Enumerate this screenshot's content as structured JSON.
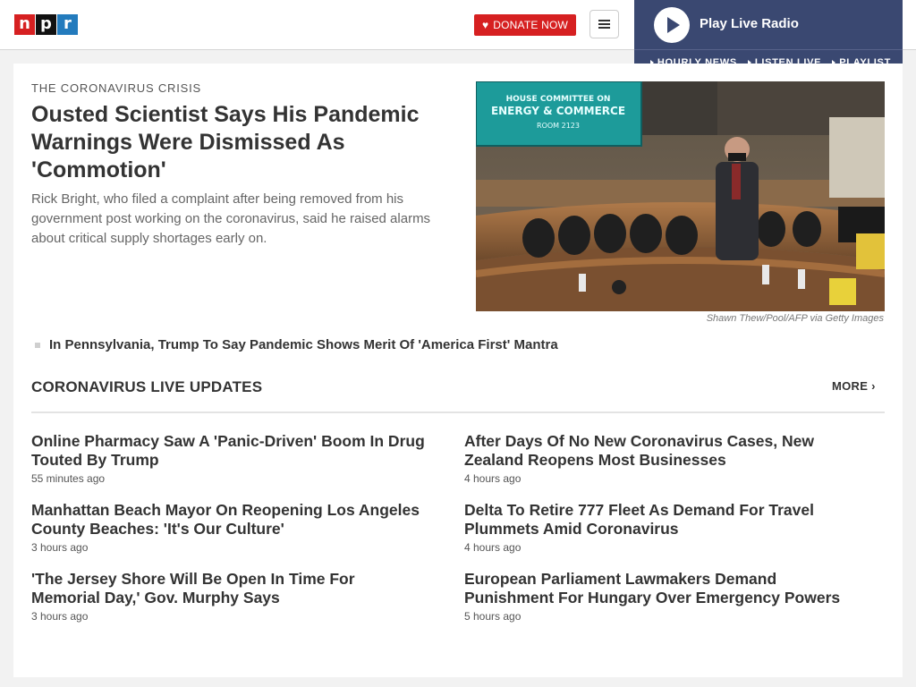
{
  "header": {
    "logo": [
      "n",
      "p",
      "r"
    ],
    "donate_label": "DONATE NOW",
    "menu_icon": "hamburger-menu-icon"
  },
  "live_radio": {
    "play_label": "Play Live Radio",
    "links": [
      "HOURLY NEWS",
      "LISTEN LIVE",
      "PLAYLIST"
    ]
  },
  "lead": {
    "kicker": "THE CORONAVIRUS CRISIS",
    "headline": "Ousted Scientist Says His Pandemic Warnings Were Dismissed As 'Commotion'",
    "teaser": "Rick Bright, who filed a complaint after being removed from his government post working on the coronavirus, said he raised alarms about critical supply shortages early on.",
    "photo_credit": "Shawn Thew/Pool/AFP via Getty Images",
    "photo_screen_text": [
      "HOUSE COMMITTEE ON",
      "ENERGY & COMMERCE",
      "ROOM 2123"
    ],
    "related": "In Pennsylvania, Trump To Say Pandemic Shows Merit Of 'America First' Mantra"
  },
  "live_updates": {
    "title": "CORONAVIRUS LIVE UPDATES",
    "more_label": "MORE ›",
    "stories": [
      {
        "title": "Online Pharmacy Saw A 'Panic-Driven' Boom In Drug Touted By Trump",
        "time": "55 minutes ago"
      },
      {
        "title": "After Days Of No New Coronavirus Cases, New Zealand Reopens Most Businesses",
        "time": "4 hours ago"
      },
      {
        "title": "Manhattan Beach Mayor On Reopening Los Angeles County Beaches: 'It's Our Culture'",
        "time": "3 hours ago"
      },
      {
        "title": "Delta To Retire 777 Fleet As Demand For Travel Plummets Amid Coronavirus",
        "time": "4 hours ago"
      },
      {
        "title": "'The Jersey Shore Will Be Open In Time For Memorial Day,' Gov. Murphy Says",
        "time": "3 hours ago"
      },
      {
        "title": "European Parliament Lawmakers Demand Punishment For Hungary Over Emergency Powers",
        "time": "5 hours ago"
      }
    ]
  },
  "colors": {
    "brand_red": "#d62021",
    "brand_blue": "#237bbd",
    "radio_bg": "#3a4871"
  }
}
